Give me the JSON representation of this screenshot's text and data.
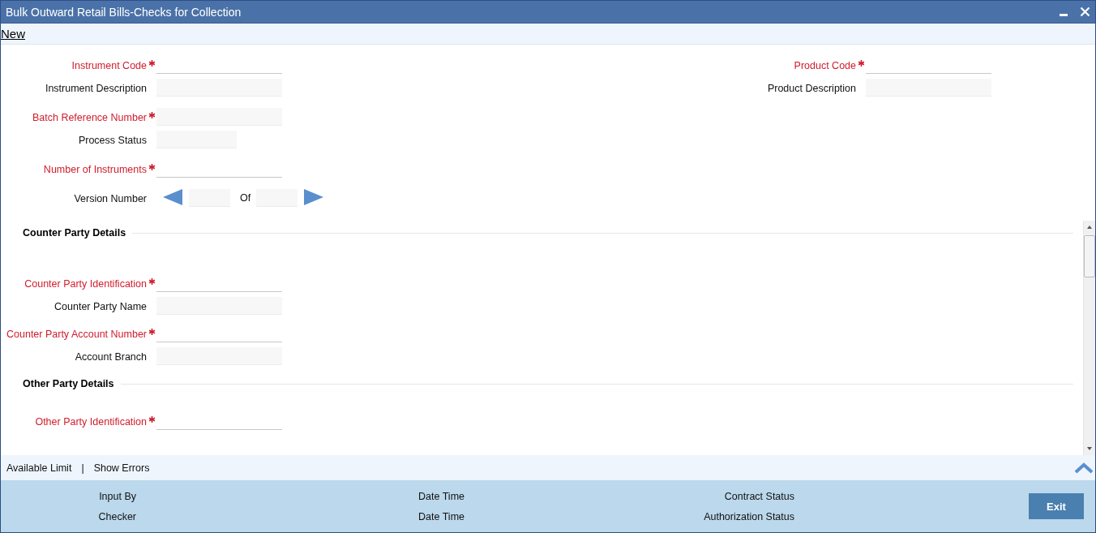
{
  "window": {
    "title": "Bulk Outward Retail Bills-Checks for Collection"
  },
  "toolbar": {
    "link": "New"
  },
  "header": {
    "left": [
      [
        {
          "label": "Instrument Code",
          "required": true,
          "kind": "input"
        },
        {
          "label": "Instrument Description",
          "required": false,
          "kind": "readonly"
        }
      ],
      [
        {
          "label": "Batch Reference Number",
          "required": true,
          "kind": "readonly"
        },
        {
          "label": "Process Status",
          "required": false,
          "kind": "short"
        }
      ],
      [
        {
          "label": "Number of Instruments",
          "required": true,
          "kind": "input"
        }
      ],
      [
        {
          "label": "Version Number",
          "required": false,
          "kind": "version",
          "of": "Of"
        }
      ]
    ],
    "right": [
      [
        {
          "label": "Product Code",
          "required": true,
          "kind": "input"
        },
        {
          "label": "Product Description",
          "required": false,
          "kind": "readonly"
        }
      ]
    ]
  },
  "sections": [
    {
      "title": "Counter Party Details",
      "groups": [
        [
          {
            "label": "Counter Party Identification",
            "required": true,
            "kind": "input"
          },
          {
            "label": "Counter Party Name",
            "required": false,
            "kind": "readonly"
          }
        ],
        [
          {
            "label": "Counter Party Account Number",
            "required": true,
            "kind": "input"
          },
          {
            "label": "Account Branch",
            "required": false,
            "kind": "readonly"
          }
        ]
      ]
    },
    {
      "title": "Other Party Details",
      "groups": [
        [
          {
            "label": "Other Party Identification",
            "required": true,
            "kind": "input"
          }
        ]
      ]
    }
  ],
  "links": {
    "items": [
      "Available Limit",
      "Show Errors"
    ],
    "separator": "|"
  },
  "audit": [
    [
      "Input By",
      "Date Time",
      "Contract Status"
    ],
    [
      "Checker",
      "Date Time",
      "Authorization Status"
    ]
  ],
  "exit": "Exit"
}
